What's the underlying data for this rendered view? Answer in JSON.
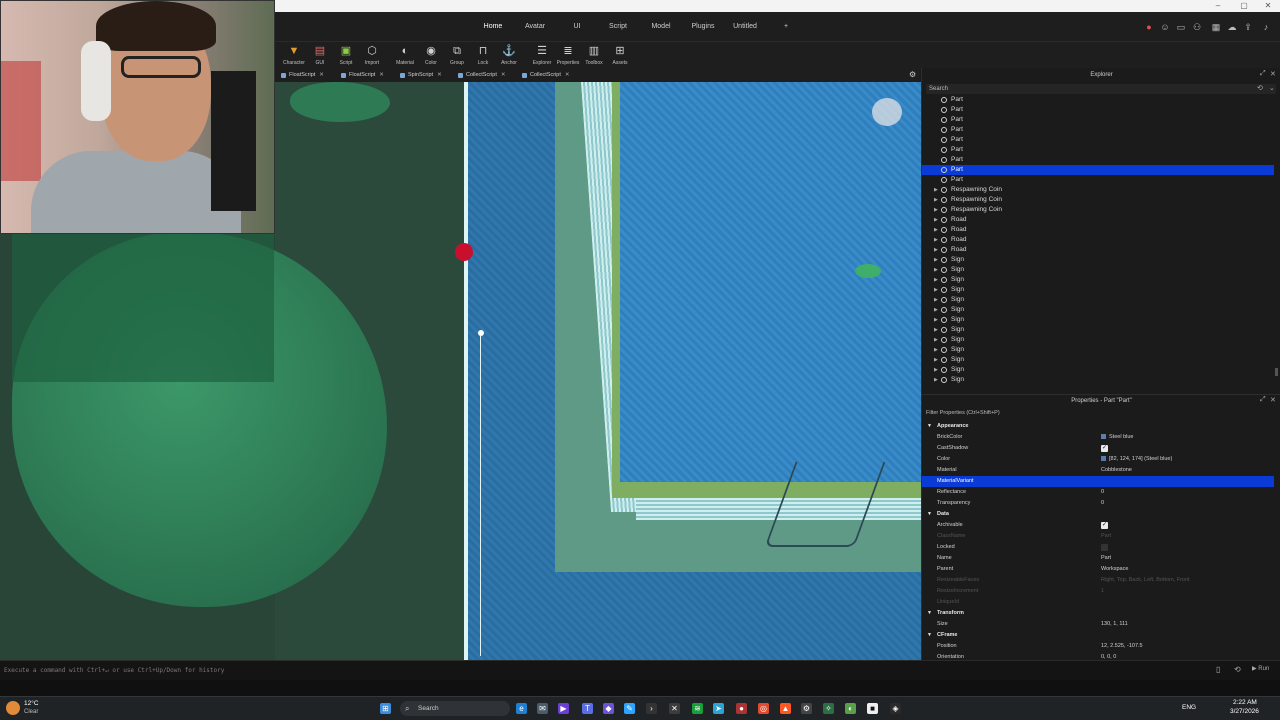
{
  "window": {
    "controls": [
      "–",
      "▢",
      "✕"
    ]
  },
  "menubar": {
    "tabs": [
      "Home",
      "Avatar",
      "UI",
      "Script",
      "Model",
      "Plugins",
      "Untitled"
    ],
    "active_tab": "Home",
    "add_tab": "+"
  },
  "ribbon": {
    "tools": [
      {
        "label": "Character",
        "icon": "character-icon"
      },
      {
        "label": "GUI",
        "icon": "gui-icon"
      },
      {
        "label": "Script",
        "icon": "script-icon"
      },
      {
        "label": "Import",
        "icon": "import-icon"
      },
      {
        "label": "Material",
        "icon": "material-icon"
      },
      {
        "label": "Color",
        "icon": "color-icon"
      },
      {
        "label": "Group",
        "icon": "group-icon"
      },
      {
        "label": "Lock",
        "icon": "lock-icon"
      },
      {
        "label": "Anchor",
        "icon": "anchor-icon"
      },
      {
        "label": "Explorer",
        "icon": "explorer-icon"
      },
      {
        "label": "Properties",
        "icon": "properties-icon"
      },
      {
        "label": "Toolbox",
        "icon": "toolbox-icon"
      },
      {
        "label": "Assets",
        "icon": "assets-icon"
      }
    ]
  },
  "script_tabs": [
    "FloatScript",
    "FloatScript",
    "SpinScript",
    "CollectScript",
    "CollectScript"
  ],
  "explorer": {
    "title": "Explorer",
    "search_placeholder": "Search",
    "items": [
      {
        "label": "Part",
        "expand": false,
        "selected": false
      },
      {
        "label": "Part",
        "expand": false,
        "selected": false
      },
      {
        "label": "Part",
        "expand": false,
        "selected": false
      },
      {
        "label": "Part",
        "expand": false,
        "selected": false
      },
      {
        "label": "Part",
        "expand": false,
        "selected": false
      },
      {
        "label": "Part",
        "expand": false,
        "selected": false
      },
      {
        "label": "Part",
        "expand": false,
        "selected": false
      },
      {
        "label": "Part",
        "expand": false,
        "selected": true
      },
      {
        "label": "Part",
        "expand": false,
        "selected": false
      },
      {
        "label": "Respawning Coin",
        "expand": true,
        "selected": false
      },
      {
        "label": "Respawning Coin",
        "expand": true,
        "selected": false
      },
      {
        "label": "Respawning Coin",
        "expand": true,
        "selected": false
      },
      {
        "label": "Road",
        "expand": true,
        "selected": false
      },
      {
        "label": "Road",
        "expand": true,
        "selected": false
      },
      {
        "label": "Road",
        "expand": true,
        "selected": false
      },
      {
        "label": "Road",
        "expand": true,
        "selected": false
      },
      {
        "label": "Sign",
        "expand": true,
        "selected": false
      },
      {
        "label": "Sign",
        "expand": true,
        "selected": false
      },
      {
        "label": "Sign",
        "expand": true,
        "selected": false
      },
      {
        "label": "Sign",
        "expand": true,
        "selected": false
      },
      {
        "label": "Sign",
        "expand": true,
        "selected": false
      },
      {
        "label": "Sign",
        "expand": true,
        "selected": false
      },
      {
        "label": "Sign",
        "expand": true,
        "selected": false
      },
      {
        "label": "Sign",
        "expand": true,
        "selected": false
      },
      {
        "label": "Sign",
        "expand": true,
        "selected": false
      },
      {
        "label": "Sign",
        "expand": true,
        "selected": false
      },
      {
        "label": "Sign",
        "expand": true,
        "selected": false
      },
      {
        "label": "Sign",
        "expand": true,
        "selected": false
      },
      {
        "label": "Sign",
        "expand": true,
        "selected": false
      }
    ]
  },
  "properties": {
    "title": "Properties - Part \"Part\"",
    "filter_placeholder": "Filter Properties (Ctrl+Shift+P)",
    "rows": [
      {
        "kind": "section",
        "name": "Appearance"
      },
      {
        "kind": "prop",
        "name": "BrickColor",
        "value": "Steel blue",
        "swatch": "#5b7fa6"
      },
      {
        "kind": "check",
        "name": "CastShadow",
        "checked": true
      },
      {
        "kind": "prop",
        "name": "Color",
        "value": "[82, 124, 174] (Steel blue)",
        "swatch": "#527cae"
      },
      {
        "kind": "prop",
        "name": "Material",
        "value": "Cobblestone"
      },
      {
        "kind": "selected",
        "name": "MaterialVariant",
        "value": ""
      },
      {
        "kind": "prop",
        "name": "Reflectance",
        "value": "0"
      },
      {
        "kind": "prop",
        "name": "Transparency",
        "value": "0"
      },
      {
        "kind": "section",
        "name": "Data"
      },
      {
        "kind": "check",
        "name": "Archivable",
        "checked": true
      },
      {
        "kind": "dim",
        "name": "ClassName",
        "value": "Part"
      },
      {
        "kind": "checkoff",
        "name": "Locked",
        "checked": false
      },
      {
        "kind": "prop",
        "name": "Name",
        "value": "Part"
      },
      {
        "kind": "prop",
        "name": "Parent",
        "value": "Workspace"
      },
      {
        "kind": "dim",
        "name": "ResizeableFaces",
        "value": "Right, Top, Back, Left, Bottom, Front"
      },
      {
        "kind": "dim",
        "name": "ResizeIncrement",
        "value": "1"
      },
      {
        "kind": "dim",
        "name": "UniqueId",
        "value": ""
      },
      {
        "kind": "section",
        "name": "Transform"
      },
      {
        "kind": "prop",
        "name": "Size",
        "value": "130, 1, 111"
      },
      {
        "kind": "section",
        "name": "CFrame"
      },
      {
        "kind": "prop",
        "name": "Position",
        "value": "12, 2.525, -107.5"
      },
      {
        "kind": "prop",
        "name": "Orientation",
        "value": "0, 0, 0"
      }
    ]
  },
  "command": {
    "placeholder": "Execute a command with Ctrl+↵ or use Ctrl+Up/Down for history"
  },
  "taskbar": {
    "weather_temp": "12°C",
    "weather_desc": "Clear",
    "search_label": "Search",
    "lang": "ENG",
    "time": "2:22 AM",
    "date": "3/27/2026"
  },
  "colors": {
    "accent_selected": "#0a3bd6",
    "pool_water": "#2b6da0",
    "grass": "#2b4a3c"
  }
}
